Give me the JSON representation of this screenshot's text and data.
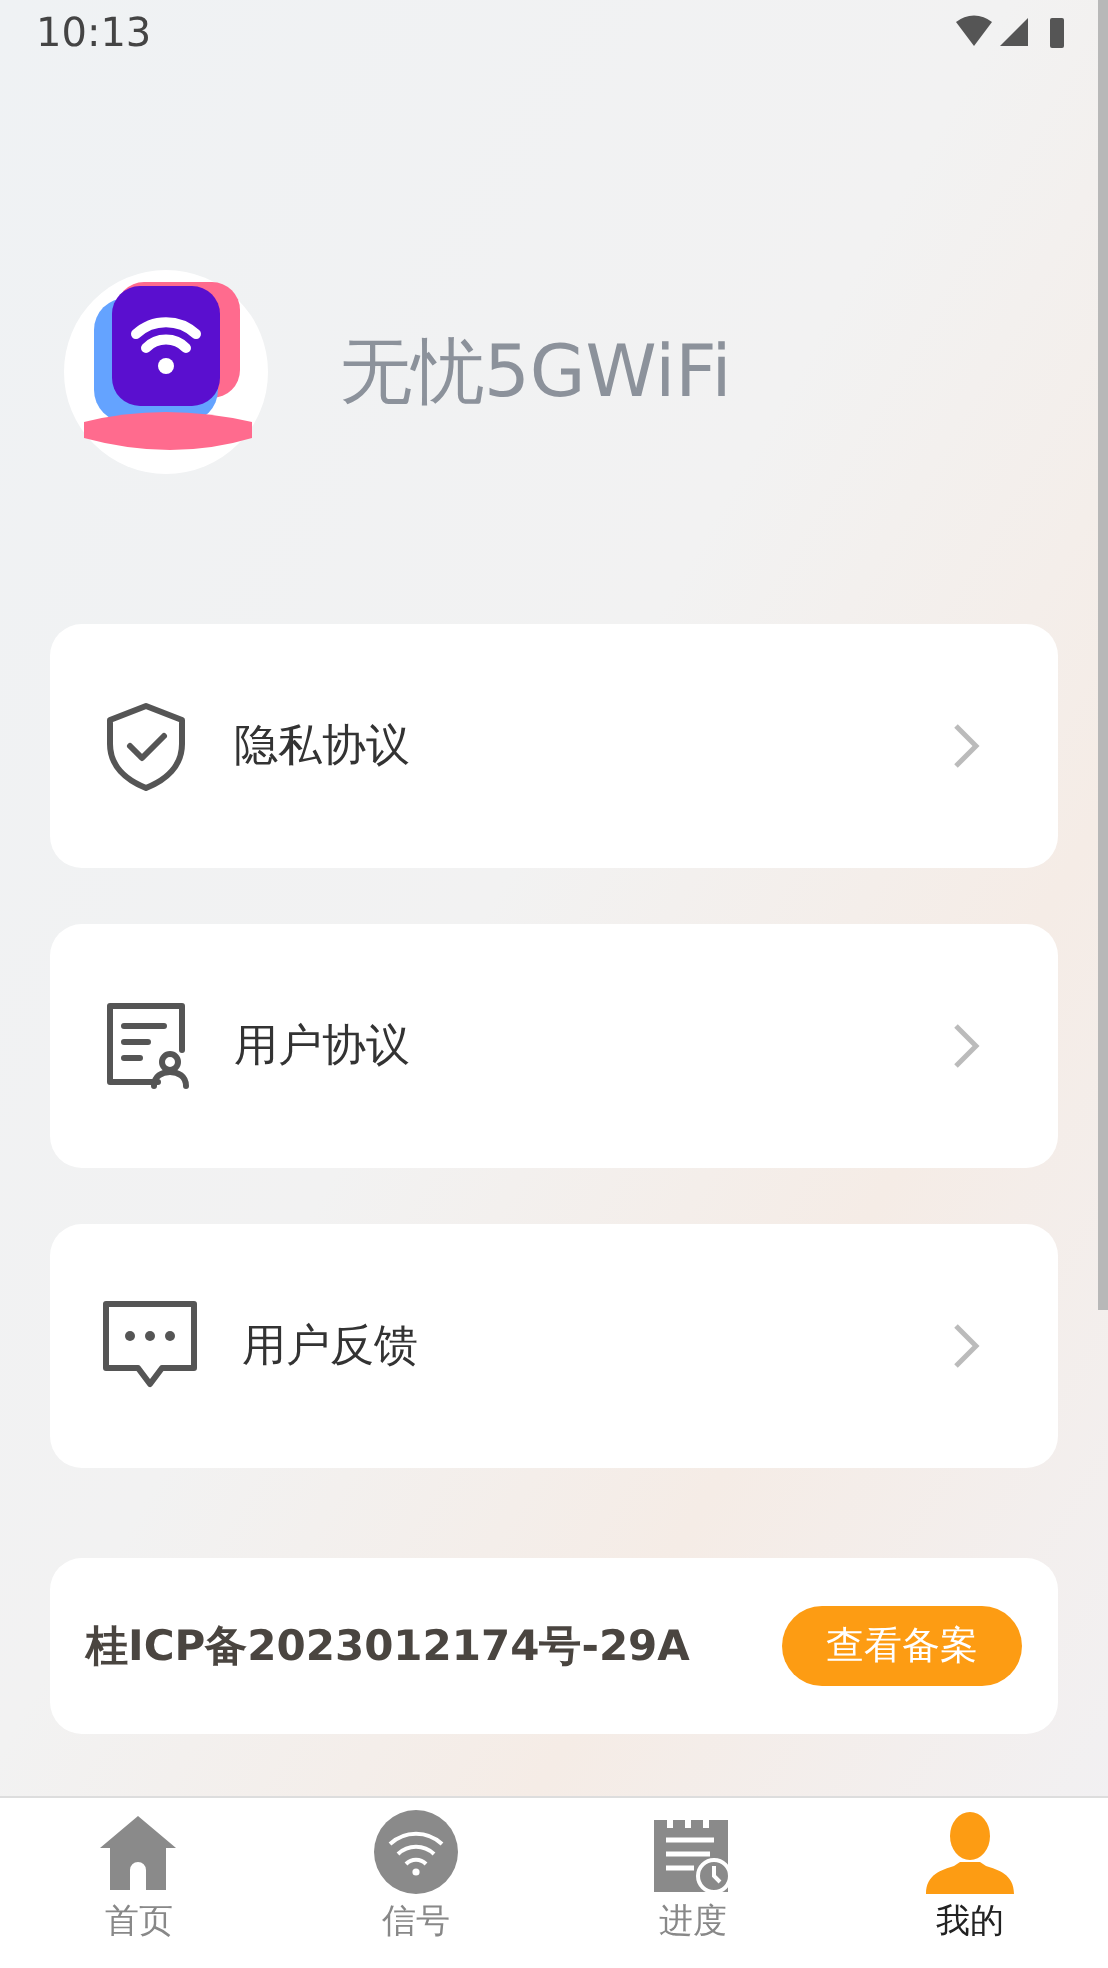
{
  "status_bar": {
    "time": "10:13"
  },
  "profile": {
    "name": "无忧5GWiFi"
  },
  "menu": [
    {
      "kind": "shield",
      "label": "隐私协议"
    },
    {
      "kind": "document",
      "label": "用户协议"
    },
    {
      "kind": "chat",
      "label": "用户反馈"
    }
  ],
  "icp": {
    "text": "桂ICP备2023012174号-29A",
    "button": "查看备案"
  },
  "tabs": [
    {
      "kind": "home",
      "label": "首页",
      "selected": false
    },
    {
      "kind": "signal",
      "label": "信号",
      "selected": false
    },
    {
      "kind": "progress",
      "label": "进度",
      "selected": false
    },
    {
      "kind": "user",
      "label": "我的",
      "selected": true
    }
  ]
}
